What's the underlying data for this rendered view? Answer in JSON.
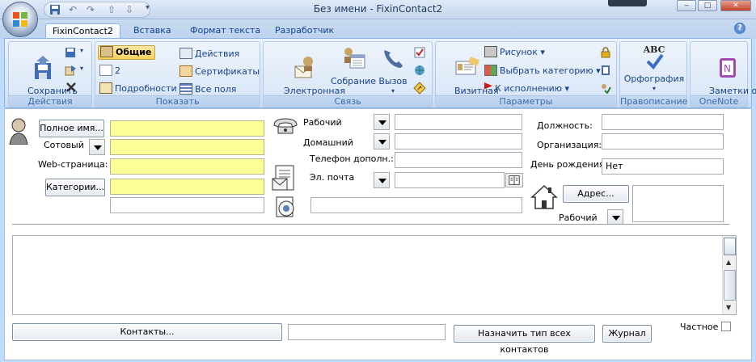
{
  "window": {
    "title": "Без имени - FixinContact2",
    "minimize": "‒",
    "maximize": "□",
    "close": "✕"
  },
  "qat": {
    "save": "save-icon",
    "undo": "↶",
    "redo": "↷",
    "up": "⇧",
    "down": "⇩",
    "more": "▾"
  },
  "tabs": [
    "FixinContact2",
    "Вставка",
    "Формат текста",
    "Разработчик"
  ],
  "help": "?",
  "ribbon": {
    "actions": {
      "save_close": "Сохранить\nи закрыть",
      "label": "Действия"
    },
    "show": {
      "general": "Общие",
      "two": "2",
      "details": "Подробности",
      "activities": "Действия",
      "certificates": "Сертификаты",
      "all_fields": "Все поля",
      "label": "Показать"
    },
    "communicate": {
      "email": "Электронная\nпочта",
      "meeting": "Собрание",
      "call": "Вызов",
      "label": "Связь"
    },
    "options": {
      "business_card": "Визитная\nкарточка",
      "picture": "Рисунок",
      "categorize": "Выбрать категорию",
      "followup": "К исполнению",
      "label": "Параметры"
    },
    "proofing": {
      "spelling": "Орфография",
      "abc": "ABC",
      "label": "Правописание"
    },
    "onenote": {
      "notes": "Заметки о\nконтакте",
      "label": "OneNote"
    }
  },
  "form": {
    "full_name_btn": "Полное имя...",
    "mobile_label": "Сотовый",
    "web_label": "Web-страница:",
    "categories_btn": "Категории...",
    "phone_work": "Рабочий",
    "phone_home": "Домашний",
    "phone_extra": "Телефон дополн.:",
    "email_label": "Эл. почта",
    "job_title": "Должность:",
    "company": "Организация:",
    "birthday": "День рождения:",
    "birthday_value": "Нет",
    "address_btn": "Адрес...",
    "address_type": "Рабочий",
    "contacts_btn": "Контакты...",
    "assign_btn": "Назначить тип всех контактов",
    "journal_btn": "Журнал",
    "private_label": "Частное"
  },
  "colors": {
    "ribbon_text": "#15428b",
    "highlight": "#ffff99"
  }
}
